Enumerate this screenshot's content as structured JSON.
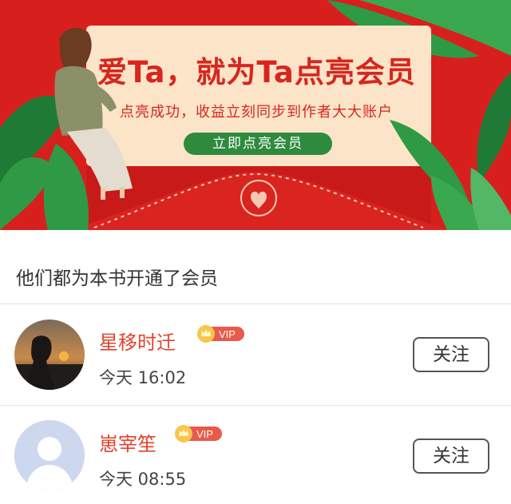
{
  "banner": {
    "headline": "爱Ta，就为Ta点亮会员",
    "subline": "点亮成功，收益立刻同步到作者大大账户",
    "cta_label": "立即点亮会员",
    "colors": {
      "background": "#d7201e",
      "card": "#fce4c8",
      "cta": "#2e8b3e"
    }
  },
  "section": {
    "title": "他们都为本书开通了会员"
  },
  "members": [
    {
      "name": "星移时迁",
      "badge": "VIP",
      "time": "今天 16:02",
      "follow_label": "关注",
      "avatar": "sunset-photo"
    },
    {
      "name": "崽宰笙",
      "badge": "VIP",
      "time": "今天 08:55",
      "follow_label": "关注",
      "avatar": "default-user-icon"
    }
  ]
}
